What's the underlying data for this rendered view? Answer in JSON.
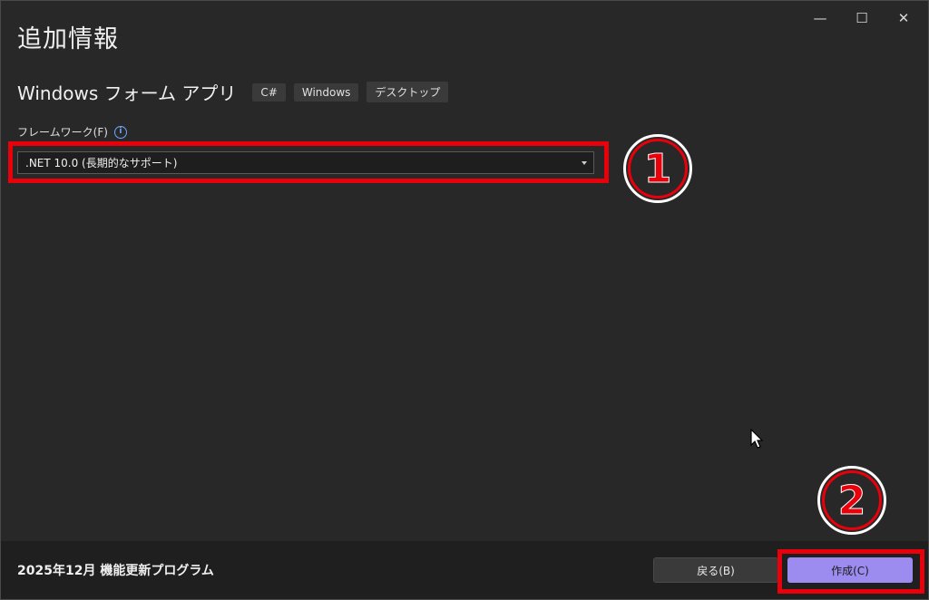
{
  "window": {
    "controls": {
      "minimize": "—",
      "maximize": "☐",
      "close": "✕"
    }
  },
  "page": {
    "title": "追加情報"
  },
  "template": {
    "name": "Windows フォーム アプリ",
    "tags": [
      "C#",
      "Windows",
      "デスクトップ"
    ]
  },
  "framework": {
    "label": "フレームワーク(F)",
    "info_icon": "i",
    "selected": ".NET 10.0 (長期的なサポート)"
  },
  "annotations": {
    "step1": "1",
    "step2": "2"
  },
  "footer": {
    "update_text": "2025年12月 機能更新プログラム",
    "back_label": "戻る(B)",
    "create_label": "作成(C)"
  },
  "colors": {
    "highlight": "#e8000b",
    "accent_button": "#9d8cf0",
    "info_icon": "#6ea8ff"
  }
}
